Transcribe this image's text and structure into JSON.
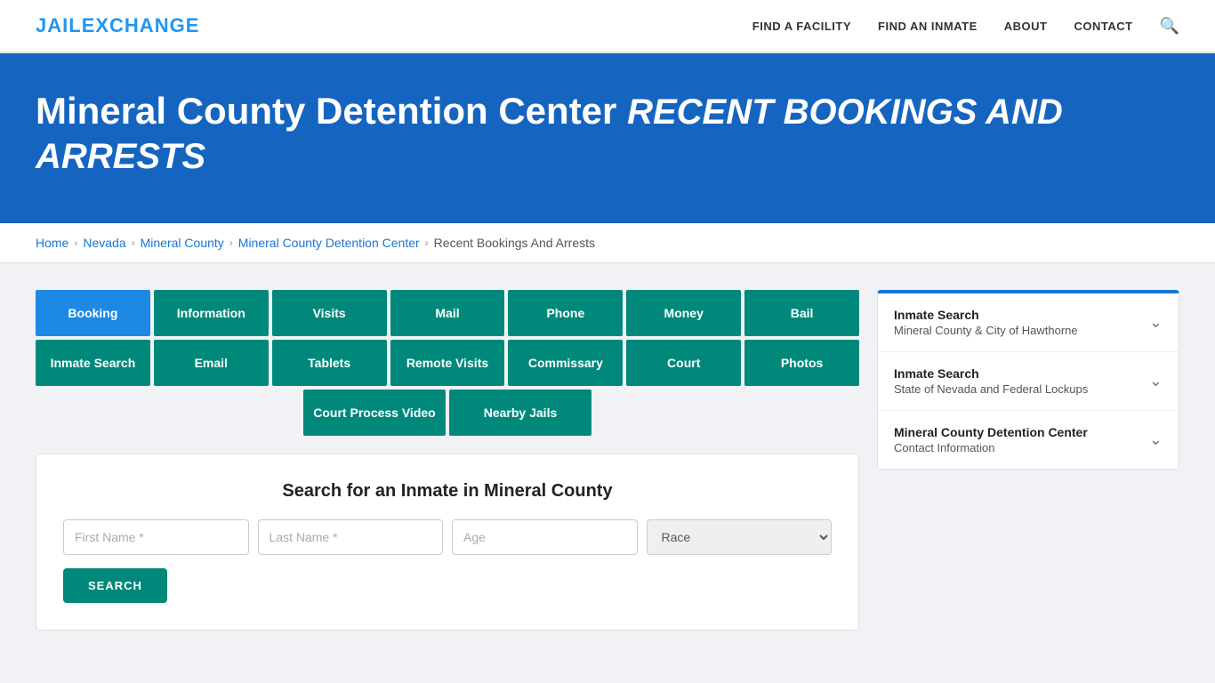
{
  "header": {
    "logo_jail": "JAIL",
    "logo_exchange": "EXCHANGE",
    "nav_items": [
      {
        "label": "FIND A FACILITY",
        "id": "find-facility"
      },
      {
        "label": "FIND AN INMATE",
        "id": "find-inmate"
      },
      {
        "label": "ABOUT",
        "id": "about"
      },
      {
        "label": "CONTACT",
        "id": "contact"
      }
    ]
  },
  "hero": {
    "title_main": "Mineral County Detention Center",
    "title_italic": "RECENT BOOKINGS AND ARRESTS"
  },
  "breadcrumb": {
    "items": [
      {
        "label": "Home",
        "id": "bc-home"
      },
      {
        "label": "Nevada",
        "id": "bc-nevada"
      },
      {
        "label": "Mineral County",
        "id": "bc-mineral"
      },
      {
        "label": "Mineral County Detention Center",
        "id": "bc-detention"
      },
      {
        "label": "Recent Bookings And Arrests",
        "id": "bc-current"
      }
    ]
  },
  "nav_buttons_row1": [
    {
      "label": "Booking",
      "style": "blue"
    },
    {
      "label": "Information",
      "style": "teal"
    },
    {
      "label": "Visits",
      "style": "teal"
    },
    {
      "label": "Mail",
      "style": "teal"
    },
    {
      "label": "Phone",
      "style": "teal"
    },
    {
      "label": "Money",
      "style": "teal"
    },
    {
      "label": "Bail",
      "style": "teal"
    }
  ],
  "nav_buttons_row2": [
    {
      "label": "Inmate Search",
      "style": "teal"
    },
    {
      "label": "Email",
      "style": "teal"
    },
    {
      "label": "Tablets",
      "style": "teal"
    },
    {
      "label": "Remote Visits",
      "style": "teal"
    },
    {
      "label": "Commissary",
      "style": "teal"
    },
    {
      "label": "Court",
      "style": "teal"
    },
    {
      "label": "Photos",
      "style": "teal"
    }
  ],
  "nav_buttons_row3": [
    {
      "label": "Court Process Video",
      "style": "teal"
    },
    {
      "label": "Nearby Jails",
      "style": "teal"
    }
  ],
  "search_section": {
    "title": "Search for an Inmate in Mineral County",
    "first_name_placeholder": "First Name *",
    "last_name_placeholder": "Last Name *",
    "age_placeholder": "Age",
    "race_placeholder": "Race",
    "button_label": "SEARCH"
  },
  "sidebar": {
    "items": [
      {
        "title": "Inmate Search",
        "subtitle": "Mineral County & City of Hawthorne",
        "id": "sidebar-inmate-search-mineral"
      },
      {
        "title": "Inmate Search",
        "subtitle": "State of Nevada and Federal Lockups",
        "id": "sidebar-inmate-search-nevada"
      },
      {
        "title": "Mineral County Detention Center",
        "subtitle": "Contact Information",
        "id": "sidebar-contact-info"
      }
    ]
  }
}
